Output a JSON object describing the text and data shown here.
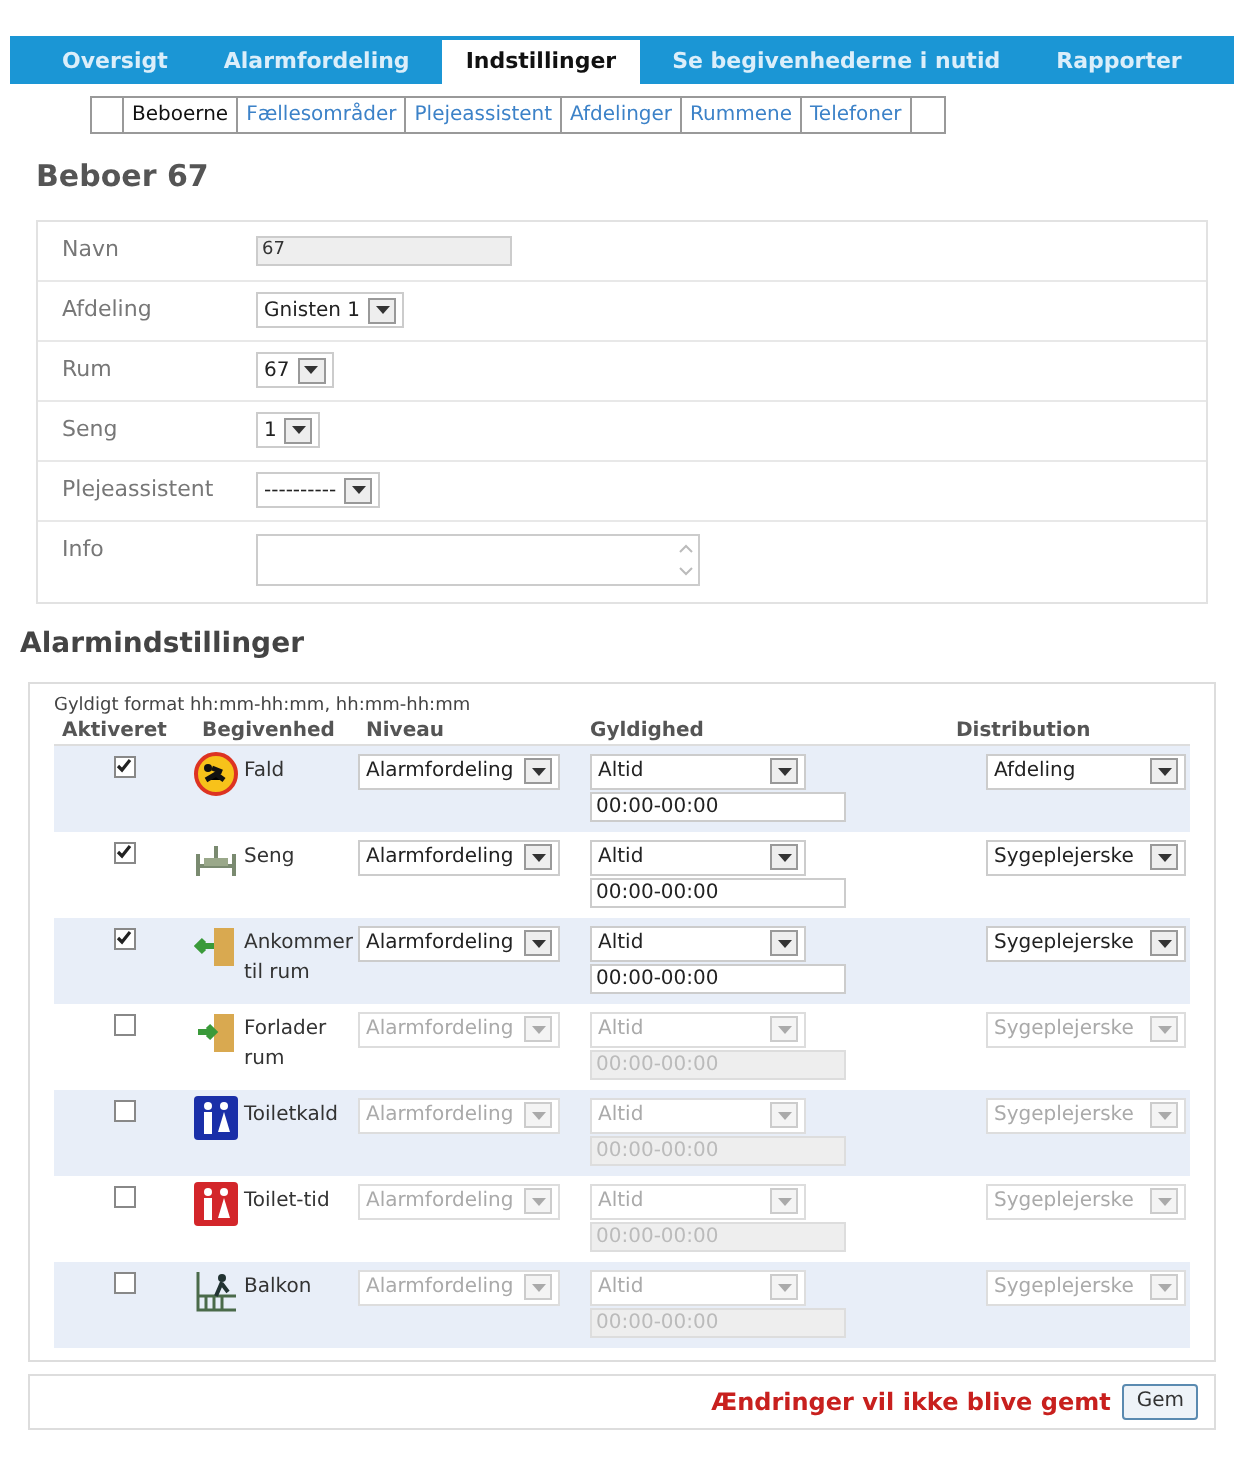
{
  "main_tabs": [
    {
      "label": "Oversigt",
      "selected": false
    },
    {
      "label": "Alarmfordeling",
      "selected": false
    },
    {
      "label": "Indstillinger",
      "selected": true
    },
    {
      "label": "Se begivenhederne i nutid",
      "selected": false
    },
    {
      "label": "Rapporter",
      "selected": false
    }
  ],
  "sub_tabs": [
    {
      "label": "Beboerne",
      "selected": true
    },
    {
      "label": "Fællesområder",
      "selected": false
    },
    {
      "label": "Plejeassistent",
      "selected": false
    },
    {
      "label": "Afdelinger",
      "selected": false
    },
    {
      "label": "Rummene",
      "selected": false
    },
    {
      "label": "Telefoner",
      "selected": false
    }
  ],
  "title": "Beboer 67",
  "form": [
    {
      "label": "Navn",
      "kind": "text",
      "value": "67"
    },
    {
      "label": "Afdeling",
      "kind": "select",
      "value": "Gnisten 1"
    },
    {
      "label": "Rum",
      "kind": "select",
      "value": "67"
    },
    {
      "label": "Seng",
      "kind": "select",
      "value": "1"
    },
    {
      "label": "Plejeassistent",
      "kind": "select",
      "value": "----------"
    },
    {
      "label": "Info",
      "kind": "textarea"
    }
  ],
  "alarm_title": "Alarmindstillinger",
  "format_hint": "Gyldigt format hh:mm-hh:mm, hh:mm-hh:mm",
  "columns": [
    "Aktiveret",
    "Begivenhed",
    "Niveau",
    "Gyldighed",
    "Distribution"
  ],
  "events": [
    {
      "checked": true,
      "kind": "fall",
      "name": "Fald",
      "level": "Alarmfordeling",
      "validity": "Altid",
      "time": "00:00-00:00",
      "distribution": "Afdeling"
    },
    {
      "checked": true,
      "kind": "bed",
      "name": "Seng",
      "level": "Alarmfordeling",
      "validity": "Altid",
      "time": "00:00-00:00",
      "distribution": "Sygeplejerske"
    },
    {
      "checked": true,
      "kind": "arrive",
      "name": "Ankommer til rum",
      "level": "Alarmfordeling",
      "validity": "Altid",
      "time": "00:00-00:00",
      "distribution": "Sygeplejerske"
    },
    {
      "checked": false,
      "kind": "leave",
      "name": "Forlader rum",
      "level": "Alarmfordeling",
      "validity": "Altid",
      "time": "00:00-00:00",
      "distribution": "Sygeplejerske"
    },
    {
      "checked": false,
      "kind": "toilet",
      "name": "Toiletkald",
      "level": "Alarmfordeling",
      "validity": "Altid",
      "time": "00:00-00:00",
      "distribution": "Sygeplejerske"
    },
    {
      "checked": false,
      "kind": "toilet_time",
      "name": "Toilet-tid",
      "level": "Alarmfordeling",
      "validity": "Altid",
      "time": "00:00-00:00",
      "distribution": "Sygeplejerske"
    },
    {
      "checked": false,
      "kind": "balcony",
      "name": "Balkon",
      "level": "Alarmfordeling",
      "validity": "Altid",
      "time": "00:00-00:00",
      "distribution": "Sygeplejerske"
    }
  ],
  "footer": {
    "warning": "Ændringer vil ikke blive gemt",
    "save": "Gem"
  }
}
